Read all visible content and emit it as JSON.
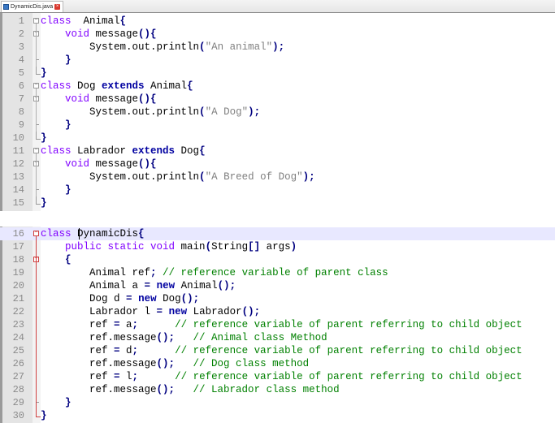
{
  "tab": {
    "filename": "DynamicDis.java",
    "save_icon": "save-icon",
    "close_icon": "close-icon"
  },
  "colors": {
    "keyword": "#8000ff",
    "keyword_bold": "#0000a0",
    "operator": "#000080",
    "string": "#808080",
    "comment": "#008000",
    "current_line": "#e8e8ff",
    "fold_active": "#d04040"
  },
  "editor": {
    "top_panel": {
      "lines": [
        {
          "n": "1",
          "tokens": [
            [
              "kw",
              "class"
            ],
            [
              "",
              "  Animal"
            ],
            [
              "op",
              "{"
            ]
          ]
        },
        {
          "n": "2",
          "tokens": [
            [
              "",
              "    "
            ],
            [
              "kw",
              "void"
            ],
            [
              "",
              " message"
            ],
            [
              "op",
              "(){"
            ]
          ]
        },
        {
          "n": "3",
          "tokens": [
            [
              "",
              "        System.out.println"
            ],
            [
              "op",
              "("
            ],
            [
              "str",
              "\"An animal\""
            ],
            [
              "op",
              ");"
            ]
          ]
        },
        {
          "n": "4",
          "tokens": [
            [
              "",
              "    "
            ],
            [
              "op",
              "}"
            ]
          ]
        },
        {
          "n": "5",
          "tokens": [
            [
              "op",
              "}"
            ]
          ]
        },
        {
          "n": "6",
          "tokens": [
            [
              "kw",
              "class"
            ],
            [
              "",
              " Dog "
            ],
            [
              "kw2",
              "extends"
            ],
            [
              "",
              " Animal"
            ],
            [
              "op",
              "{"
            ]
          ]
        },
        {
          "n": "7",
          "tokens": [
            [
              "",
              "    "
            ],
            [
              "kw",
              "void"
            ],
            [
              "",
              " message"
            ],
            [
              "op",
              "(){"
            ]
          ]
        },
        {
          "n": "8",
          "tokens": [
            [
              "",
              "        System.out.println"
            ],
            [
              "op",
              "("
            ],
            [
              "str",
              "\"A Dog\""
            ],
            [
              "op",
              ");"
            ]
          ]
        },
        {
          "n": "9",
          "tokens": [
            [
              "",
              "    "
            ],
            [
              "op",
              "}"
            ]
          ]
        },
        {
          "n": "10",
          "tokens": [
            [
              "op",
              "}"
            ]
          ]
        },
        {
          "n": "11",
          "tokens": [
            [
              "kw",
              "class"
            ],
            [
              "",
              " Labrador "
            ],
            [
              "kw2",
              "extends"
            ],
            [
              "",
              " Dog"
            ],
            [
              "op",
              "{"
            ]
          ]
        },
        {
          "n": "12",
          "tokens": [
            [
              "",
              "    "
            ],
            [
              "kw",
              "void"
            ],
            [
              "",
              " message"
            ],
            [
              "op",
              "(){"
            ]
          ]
        },
        {
          "n": "13",
          "tokens": [
            [
              "",
              "        System.out.println"
            ],
            [
              "op",
              "("
            ],
            [
              "str",
              "\"A Breed of Dog\""
            ],
            [
              "op",
              ");"
            ]
          ]
        },
        {
          "n": "14",
          "tokens": [
            [
              "",
              "    "
            ],
            [
              "op",
              "}"
            ]
          ]
        },
        {
          "n": "15",
          "tokens": [
            [
              "op",
              "}"
            ]
          ]
        }
      ]
    },
    "bottom_panel": {
      "lines": [
        {
          "n": "16",
          "tokens": [
            [
              "kw",
              "class"
            ],
            [
              "",
              " DynamicDis"
            ],
            [
              "op",
              "{"
            ]
          ],
          "current": true
        },
        {
          "n": "17",
          "tokens": [
            [
              "",
              "    "
            ],
            [
              "kw",
              "public static void"
            ],
            [
              "",
              " main"
            ],
            [
              "op",
              "("
            ],
            [
              "",
              "String"
            ],
            [
              "op",
              "[]"
            ],
            [
              "",
              " args"
            ],
            [
              "op",
              ")"
            ]
          ]
        },
        {
          "n": "18",
          "tokens": [
            [
              "",
              "    "
            ],
            [
              "op",
              "{"
            ]
          ]
        },
        {
          "n": "19",
          "tokens": [
            [
              "",
              "        Animal ref"
            ],
            [
              "op",
              ";"
            ],
            [
              "cm",
              " // reference variable of parent class"
            ]
          ]
        },
        {
          "n": "20",
          "tokens": [
            [
              "",
              "        Animal a "
            ],
            [
              "op",
              "="
            ],
            [
              "",
              " "
            ],
            [
              "kw2",
              "new"
            ],
            [
              "",
              " Animal"
            ],
            [
              "op",
              "();"
            ]
          ]
        },
        {
          "n": "21",
          "tokens": [
            [
              "",
              "        Dog d "
            ],
            [
              "op",
              "="
            ],
            [
              "",
              " "
            ],
            [
              "kw2",
              "new"
            ],
            [
              "",
              " Dog"
            ],
            [
              "op",
              "();"
            ]
          ]
        },
        {
          "n": "22",
          "tokens": [
            [
              "",
              "        Labrador l "
            ],
            [
              "op",
              "="
            ],
            [
              "",
              " "
            ],
            [
              "kw2",
              "new"
            ],
            [
              "",
              " Labrador"
            ],
            [
              "op",
              "();"
            ]
          ]
        },
        {
          "n": "23",
          "tokens": [
            [
              "",
              "        ref "
            ],
            [
              "op",
              "="
            ],
            [
              "",
              " a"
            ],
            [
              "op",
              ";"
            ],
            [
              "cm",
              "      // reference variable of parent referring to child object"
            ]
          ]
        },
        {
          "n": "24",
          "tokens": [
            [
              "",
              "        ref.message"
            ],
            [
              "op",
              "();"
            ],
            [
              "cm",
              "   // Animal class Method"
            ]
          ]
        },
        {
          "n": "25",
          "tokens": [
            [
              "",
              "        ref "
            ],
            [
              "op",
              "="
            ],
            [
              "",
              " d"
            ],
            [
              "op",
              ";"
            ],
            [
              "cm",
              "      // reference variable of parent referring to child object"
            ]
          ]
        },
        {
          "n": "26",
          "tokens": [
            [
              "",
              "        ref.message"
            ],
            [
              "op",
              "();"
            ],
            [
              "cm",
              "   // Dog class method"
            ]
          ]
        },
        {
          "n": "27",
          "tokens": [
            [
              "",
              "        ref "
            ],
            [
              "op",
              "="
            ],
            [
              "",
              " l"
            ],
            [
              "op",
              ";"
            ],
            [
              "cm",
              "      // reference variable of parent referring to child object"
            ]
          ]
        },
        {
          "n": "28",
          "tokens": [
            [
              "",
              "        ref.message"
            ],
            [
              "op",
              "();"
            ],
            [
              "cm",
              "   // Labrador class method"
            ]
          ]
        },
        {
          "n": "29",
          "tokens": [
            [
              "",
              "    "
            ],
            [
              "op",
              "}"
            ]
          ]
        },
        {
          "n": "30",
          "tokens": [
            [
              "op",
              "}"
            ]
          ]
        }
      ]
    }
  }
}
